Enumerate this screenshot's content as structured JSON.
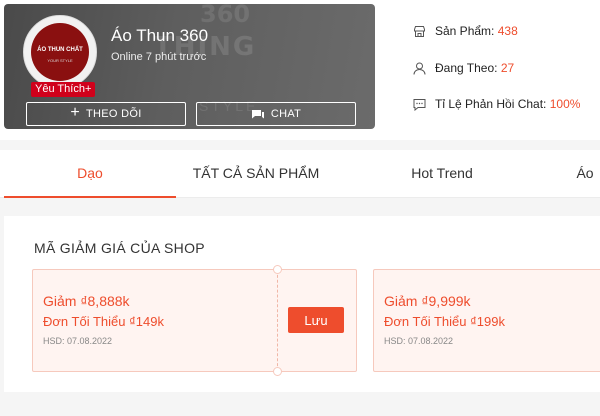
{
  "shop": {
    "name": "Áo Thun 360",
    "online_status": "Online 7 phút trước",
    "badge": "Yêu Thích+",
    "avatar_logo_text": "ÁO THUN CHẤT",
    "avatar_logo_sub": "YOUR STYLE",
    "follow_label": "THEO DÕI",
    "chat_label": "CHAT",
    "banner_bg_texts": [
      "360",
      "THING",
      "STYLE"
    ]
  },
  "stats": {
    "products": {
      "label": "Sản Phẩm:",
      "value": "438",
      "icon": "store-icon"
    },
    "following": {
      "label": "Đang Theo:",
      "value": "27",
      "icon": "user-icon"
    },
    "response": {
      "label": "Tỉ Lệ Phản Hồi Chat:",
      "value": "100%",
      "icon": "chat-bubble-icon"
    }
  },
  "tabs": [
    {
      "label": "Dạo",
      "active": true
    },
    {
      "label": "TẤT CẢ SẢN PHẨM",
      "active": false
    },
    {
      "label": "Hot Trend",
      "active": false
    },
    {
      "label": "Áo",
      "active": false
    }
  ],
  "vouchers": {
    "title": "MÃ GIẢM GIÁ CỦA SHOP",
    "items": [
      {
        "amount": "Giảm ₫8,888k",
        "min": "Đơn Tối Thiểu ₫149k",
        "expiry": "HSD: 07.08.2022",
        "button": "Lưu"
      },
      {
        "amount": "Giảm ₫9,999k",
        "min": "Đơn Tối Thiểu ₫199k",
        "expiry": "HSD: 07.08.2022"
      }
    ]
  },
  "colors": {
    "accent": "#ee4d2d",
    "badge": "#d0011b",
    "banner": "#5a5a5a"
  }
}
